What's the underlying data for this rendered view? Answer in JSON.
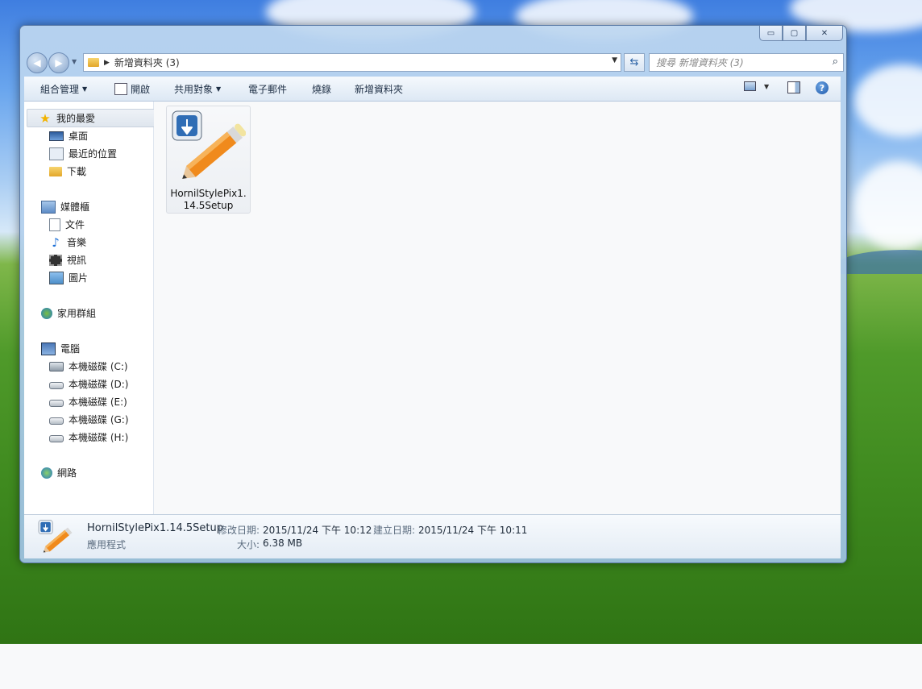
{
  "window": {
    "caption_buttons": {
      "minimize": "▭",
      "maximize": "▢",
      "close": "✕"
    },
    "address": {
      "path": "新增資料夾 (3)"
    },
    "search": {
      "placeholder": "搜尋 新增資料夾 (3)"
    }
  },
  "toolbar": {
    "organize": "組合管理",
    "open": "開啟",
    "share": "共用對象",
    "email": "電子郵件",
    "burn": "燒錄",
    "new_folder": "新增資料夾"
  },
  "sidebar": {
    "favorites": {
      "label": "我的最愛",
      "items": [
        {
          "label": "桌面"
        },
        {
          "label": "最近的位置"
        },
        {
          "label": "下載"
        }
      ]
    },
    "libraries": {
      "label": "媒體櫃",
      "items": [
        {
          "label": "文件"
        },
        {
          "label": "音樂"
        },
        {
          "label": "視訊"
        },
        {
          "label": "圖片"
        }
      ]
    },
    "homegroup": {
      "label": "家用群組"
    },
    "computer": {
      "label": "電腦",
      "items": [
        {
          "label": "本機磁碟 (C:)"
        },
        {
          "label": "本機磁碟 (D:)"
        },
        {
          "label": "本機磁碟 (E:)"
        },
        {
          "label": "本機磁碟 (G:)"
        },
        {
          "label": "本機磁碟 (H:)"
        }
      ]
    },
    "network": {
      "label": "網路"
    }
  },
  "files": [
    {
      "name": "HornilStylePix1.14.5Setup",
      "name_line1": "HornilStylePix1.",
      "name_line2": "14.5Setup"
    }
  ],
  "details": {
    "name": "HornilStylePix1.14.5Setup",
    "type": "應用程式",
    "modified_label": "修改日期:",
    "modified_value": "2015/11/24 下午 10:12",
    "created_label": "建立日期:",
    "created_value": "2015/11/24 下午 10:11",
    "size_label": "大小:",
    "size_value": "6.38 MB"
  },
  "colors": {
    "accent": "#2d64a6",
    "pencil": "#f08a1c",
    "download_arrow": "#2f6db5"
  }
}
